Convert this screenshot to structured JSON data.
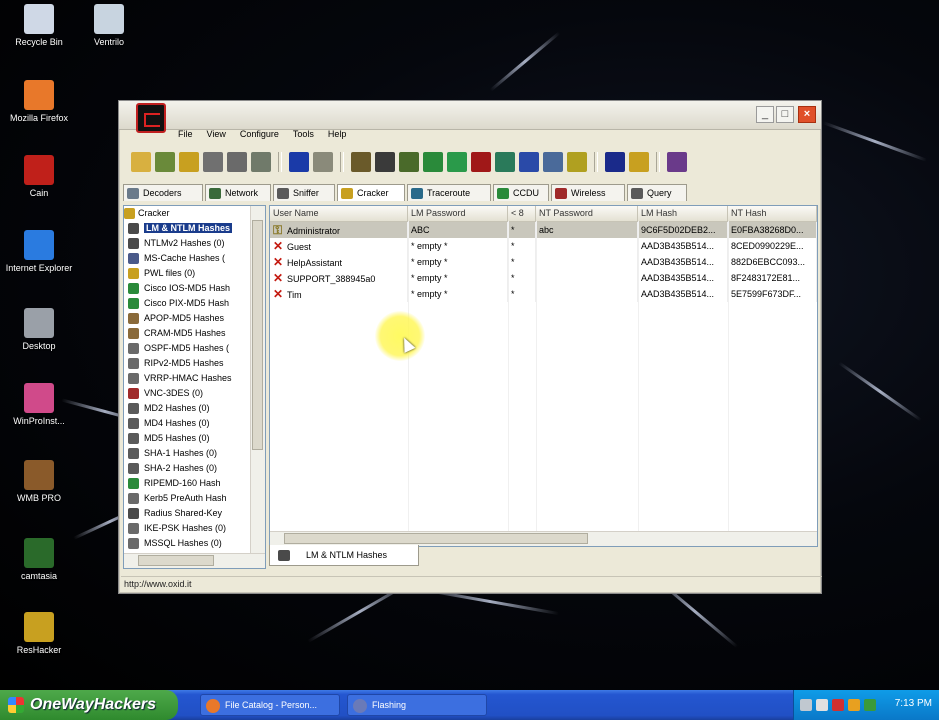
{
  "desktop_icons": [
    {
      "label": "Recycle Bin",
      "icon": "recycle-bin-icon",
      "color": "#cfd8e6"
    },
    {
      "label": "Ventrilo",
      "icon": "ventrilo-icon",
      "color": "#c8d4e0"
    },
    {
      "label": "Mozilla Firefox",
      "icon": "firefox-icon",
      "color": "#e8782a"
    },
    {
      "label": "Cain",
      "icon": "cain-icon",
      "color": "#c0201a"
    },
    {
      "label": "Internet Explorer",
      "icon": "internet-explorer-icon",
      "color": "#2a7be0"
    },
    {
      "label": "Desktop",
      "icon": "desktop-icon",
      "color": "#9aa0a8"
    },
    {
      "label": "WinProInst...",
      "icon": "installer-icon",
      "color": "#d04a8a"
    },
    {
      "label": "WMB PRO",
      "icon": "wmb-pro-icon",
      "color": "#8a5a2a"
    },
    {
      "label": "camtasia",
      "icon": "camtasia-icon",
      "color": "#2a6a2a"
    },
    {
      "label": "ResHacker",
      "icon": "reshacker-icon",
      "color": "#c8a020"
    }
  ],
  "window": {
    "menus": [
      "File",
      "View",
      "Configure",
      "Tools",
      "Help"
    ],
    "toolbar_icons": [
      {
        "icon": "open-icon",
        "color": "#d8b040"
      },
      {
        "icon": "network-adapter-icon",
        "color": "#6a8a3a"
      },
      {
        "icon": "sniffer-start-icon",
        "color": "#c8a020"
      },
      {
        "icon": "poison-icon",
        "color": "#707070"
      },
      {
        "icon": "config-grid-icon",
        "color": "#6a6a6a"
      },
      {
        "icon": "table-icon",
        "color": "#707a6a"
      },
      {
        "sep": true
      },
      {
        "icon": "add-icon",
        "color": "#1a3aa8"
      },
      {
        "icon": "trash-icon",
        "color": "#8a8a7a"
      },
      {
        "sep": true
      },
      {
        "icon": "people-icon",
        "color": "#6a5a2a"
      },
      {
        "icon": "tree-icon",
        "color": "#3a3a3a"
      },
      {
        "icon": "decoder-icon",
        "color": "#4a6a2a"
      },
      {
        "icon": "hash-icon",
        "color": "#2a8a3a"
      },
      {
        "icon": "lm-icon",
        "color": "#2a9a4a"
      },
      {
        "icon": "brute-force-icon",
        "color": "#a01818"
      },
      {
        "icon": "rainbow-icon",
        "color": "#2a7a5a"
      },
      {
        "icon": "dictionary-icon",
        "color": "#2a4aa8"
      },
      {
        "icon": "traceroute-icon",
        "color": "#4a6a9a"
      },
      {
        "icon": "wireless-icon",
        "color": "#b0a020"
      },
      {
        "sep": true
      },
      {
        "icon": "info-icon",
        "color": "#1a2a8a"
      },
      {
        "icon": "help-icon",
        "color": "#c8a020"
      },
      {
        "sep": true
      },
      {
        "icon": "user-icon",
        "color": "#6a3a8a"
      }
    ],
    "tabs": [
      {
        "label": "Decoders",
        "icon": "decoders-icon",
        "color": "#6a7a8a"
      },
      {
        "label": "Network",
        "icon": "network-icon",
        "color": "#3a6a3a"
      },
      {
        "label": "Sniffer",
        "icon": "sniffer-icon",
        "color": "#5a5a5a"
      },
      {
        "label": "Cracker",
        "icon": "cracker-icon",
        "color": "#c8a020",
        "active": true
      },
      {
        "label": "Traceroute",
        "icon": "traceroute-icon",
        "color": "#2a6a8a"
      },
      {
        "label": "CCDU",
        "icon": "ccdu-icon",
        "color": "#2a8a3a"
      },
      {
        "label": "Wireless",
        "icon": "wireless-icon",
        "color": "#a02a2a"
      },
      {
        "label": "Query",
        "icon": "query-icon",
        "color": "#5a5a5a"
      }
    ],
    "tree": [
      {
        "label": "Cracker",
        "root": true,
        "icon": "cracker-icon",
        "color": "#c8a020"
      },
      {
        "label": "LM & NTLM Hashes",
        "selected": true,
        "icon": "lm-ntlm-icon",
        "color": "#4a4a4a"
      },
      {
        "label": "NTLMv2 Hashes (0)",
        "icon": "ntlmv2-icon",
        "color": "#4a4a4a"
      },
      {
        "label": "MS-Cache Hashes (",
        "icon": "ms-cache-icon",
        "color": "#4a5a8a"
      },
      {
        "label": "PWL files (0)",
        "icon": "pwl-icon",
        "color": "#c8a020"
      },
      {
        "label": "Cisco IOS-MD5 Hash",
        "icon": "cisco-icon",
        "color": "#2a8a3a"
      },
      {
        "label": "Cisco PIX-MD5 Hash",
        "icon": "cisco-pix-icon",
        "color": "#2a8a3a"
      },
      {
        "label": "APOP-MD5 Hashes",
        "icon": "apop-icon",
        "color": "#8a6a3a"
      },
      {
        "label": "CRAM-MD5 Hashes",
        "icon": "cram-icon",
        "color": "#8a6a3a"
      },
      {
        "label": "OSPF-MD5 Hashes (",
        "icon": "ospf-icon",
        "color": "#6a6a6a"
      },
      {
        "label": "RIPv2-MD5 Hashes",
        "icon": "ripv2-icon",
        "color": "#6a6a6a"
      },
      {
        "label": "VRRP-HMAC Hashes",
        "icon": "vrrp-icon",
        "color": "#6a6a6a"
      },
      {
        "label": "VNC-3DES (0)",
        "icon": "vnc-icon",
        "color": "#a02a2a"
      },
      {
        "label": "MD2 Hashes (0)",
        "icon": "md2-icon",
        "color": "#5a5a5a"
      },
      {
        "label": "MD4 Hashes (0)",
        "icon": "md4-icon",
        "color": "#5a5a5a"
      },
      {
        "label": "MD5 Hashes (0)",
        "icon": "md5-icon",
        "color": "#5a5a5a"
      },
      {
        "label": "SHA-1 Hashes (0)",
        "icon": "sha1-icon",
        "color": "#5a5a5a"
      },
      {
        "label": "SHA-2 Hashes (0)",
        "icon": "sha2-icon",
        "color": "#5a5a5a"
      },
      {
        "label": "RIPEMD-160 Hash",
        "icon": "ripemd-icon",
        "color": "#2a8a3a"
      },
      {
        "label": "Kerb5 PreAuth Hash",
        "icon": "kerberos-icon",
        "color": "#6a6a6a"
      },
      {
        "label": "Radius Shared-Key",
        "icon": "radius-icon",
        "color": "#4a4a4a"
      },
      {
        "label": "IKE-PSK Hashes (0)",
        "icon": "ike-icon",
        "color": "#6a6a6a"
      },
      {
        "label": "MSSQL Hashes (0)",
        "icon": "mssql-icon",
        "color": "#6a6a6a"
      }
    ],
    "columns": [
      "User Name",
      "LM Password",
      "< 8",
      "NT Password",
      "LM Hash",
      "NT Hash"
    ],
    "rows": [
      {
        "user": "Administrator",
        "lm_password": "ABC",
        "lt8": "*",
        "nt_password": "abc",
        "lm_hash": "9C6F5D02DEB2...",
        "nt_hash": "E0FBA38268D0...",
        "selected": true,
        "status": "cracked"
      },
      {
        "user": "Guest",
        "lm_password": "* empty *",
        "lt8": "*",
        "nt_password": "",
        "lm_hash": "AAD3B435B514...",
        "nt_hash": "8CED0990229E...",
        "status": "x"
      },
      {
        "user": "HelpAssistant",
        "lm_password": "* empty *",
        "lt8": "*",
        "nt_password": "",
        "lm_hash": "AAD3B435B514...",
        "nt_hash": "882D6EBCC093...",
        "status": "x"
      },
      {
        "user": "SUPPORT_388945a0",
        "lm_password": "* empty *",
        "lt8": "*",
        "nt_password": "",
        "lm_hash": "AAD3B435B514...",
        "nt_hash": "8F2483172E81...",
        "status": "x"
      },
      {
        "user": "Tim",
        "lm_password": "* empty *",
        "lt8": "*",
        "nt_password": "",
        "lm_hash": "AAD3B435B514...",
        "nt_hash": "5E7599F673DF...",
        "status": "x"
      }
    ],
    "bottom_tab": "LM & NTLM Hashes",
    "status_url": "http://www.oxid.it"
  },
  "taskbar": {
    "start_label": "OneWayHackers",
    "tasks": [
      {
        "label": "File Catalog - Person...",
        "icon": "firefox-icon",
        "color": "#e8782a"
      },
      {
        "label": "Flashing",
        "icon": "flashing-icon",
        "color": "#6a7ab8"
      }
    ],
    "tray_icons": [
      {
        "icon": "tray-network-icon",
        "color": "#c0c8d0"
      },
      {
        "icon": "tray-volume-icon",
        "color": "#e0e0e0"
      },
      {
        "icon": "tray-security-icon",
        "color": "#d03030"
      },
      {
        "icon": "tray-app-icon",
        "color": "#e8a020"
      },
      {
        "icon": "tray-shield-icon",
        "color": "#3a9a3a"
      }
    ],
    "clock": "7:13 PM"
  }
}
